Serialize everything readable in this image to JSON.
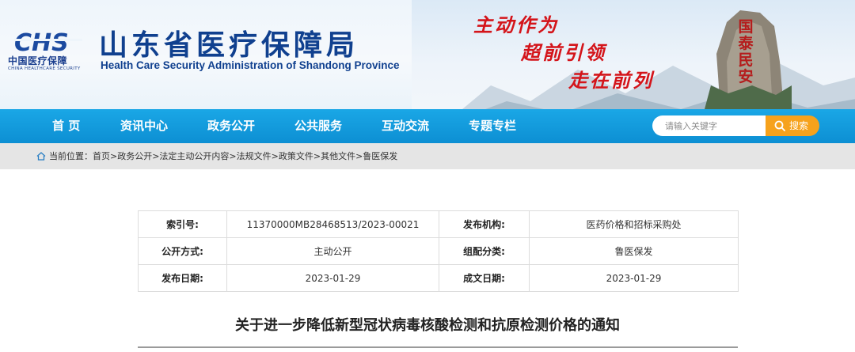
{
  "header": {
    "logo_text": "CHS",
    "logo_cn": "中国医疗保障",
    "logo_en": "CHINA HEALTHCARE SECURITY",
    "title": "山东省医疗保障局",
    "subtitle": "Health Care Security Administration of Shandong Province",
    "slogans": [
      "主动作为",
      "超前引领",
      "走在前列"
    ],
    "rock_text": "国泰民安",
    "colors": {
      "title": "#10408f",
      "slogan": "#d4141a"
    }
  },
  "nav": {
    "items": [
      "首 页",
      "资讯中心",
      "政务公开",
      "公共服务",
      "互动交流",
      "专题专栏"
    ],
    "search": {
      "placeholder": "请输入关键字",
      "button_label": "搜索"
    },
    "colors": {
      "bar": "#0d8fd3",
      "search_button": "#f6a21c"
    }
  },
  "breadcrumb": {
    "text": "当前位置：首页>政务公开>法定主动公开内容>法规文件>政策文件>其他文件>鲁医保发"
  },
  "info_table": {
    "rows": [
      [
        {
          "k": "索引号:",
          "v": "11370000MB28468513/2023-00021"
        },
        {
          "k": "发布机构:",
          "v": "医药价格和招标采购处"
        }
      ],
      [
        {
          "k": "公开方式:",
          "v": "主动公开"
        },
        {
          "k": "组配分类:",
          "v": "鲁医保发"
        }
      ],
      [
        {
          "k": "发布日期:",
          "v": "2023-01-29"
        },
        {
          "k": "成文日期:",
          "v": "2023-01-29"
        }
      ]
    ]
  },
  "document": {
    "title": "关于进一步降低新型冠状病毒核酸检测和抗原检测价格的通知"
  }
}
